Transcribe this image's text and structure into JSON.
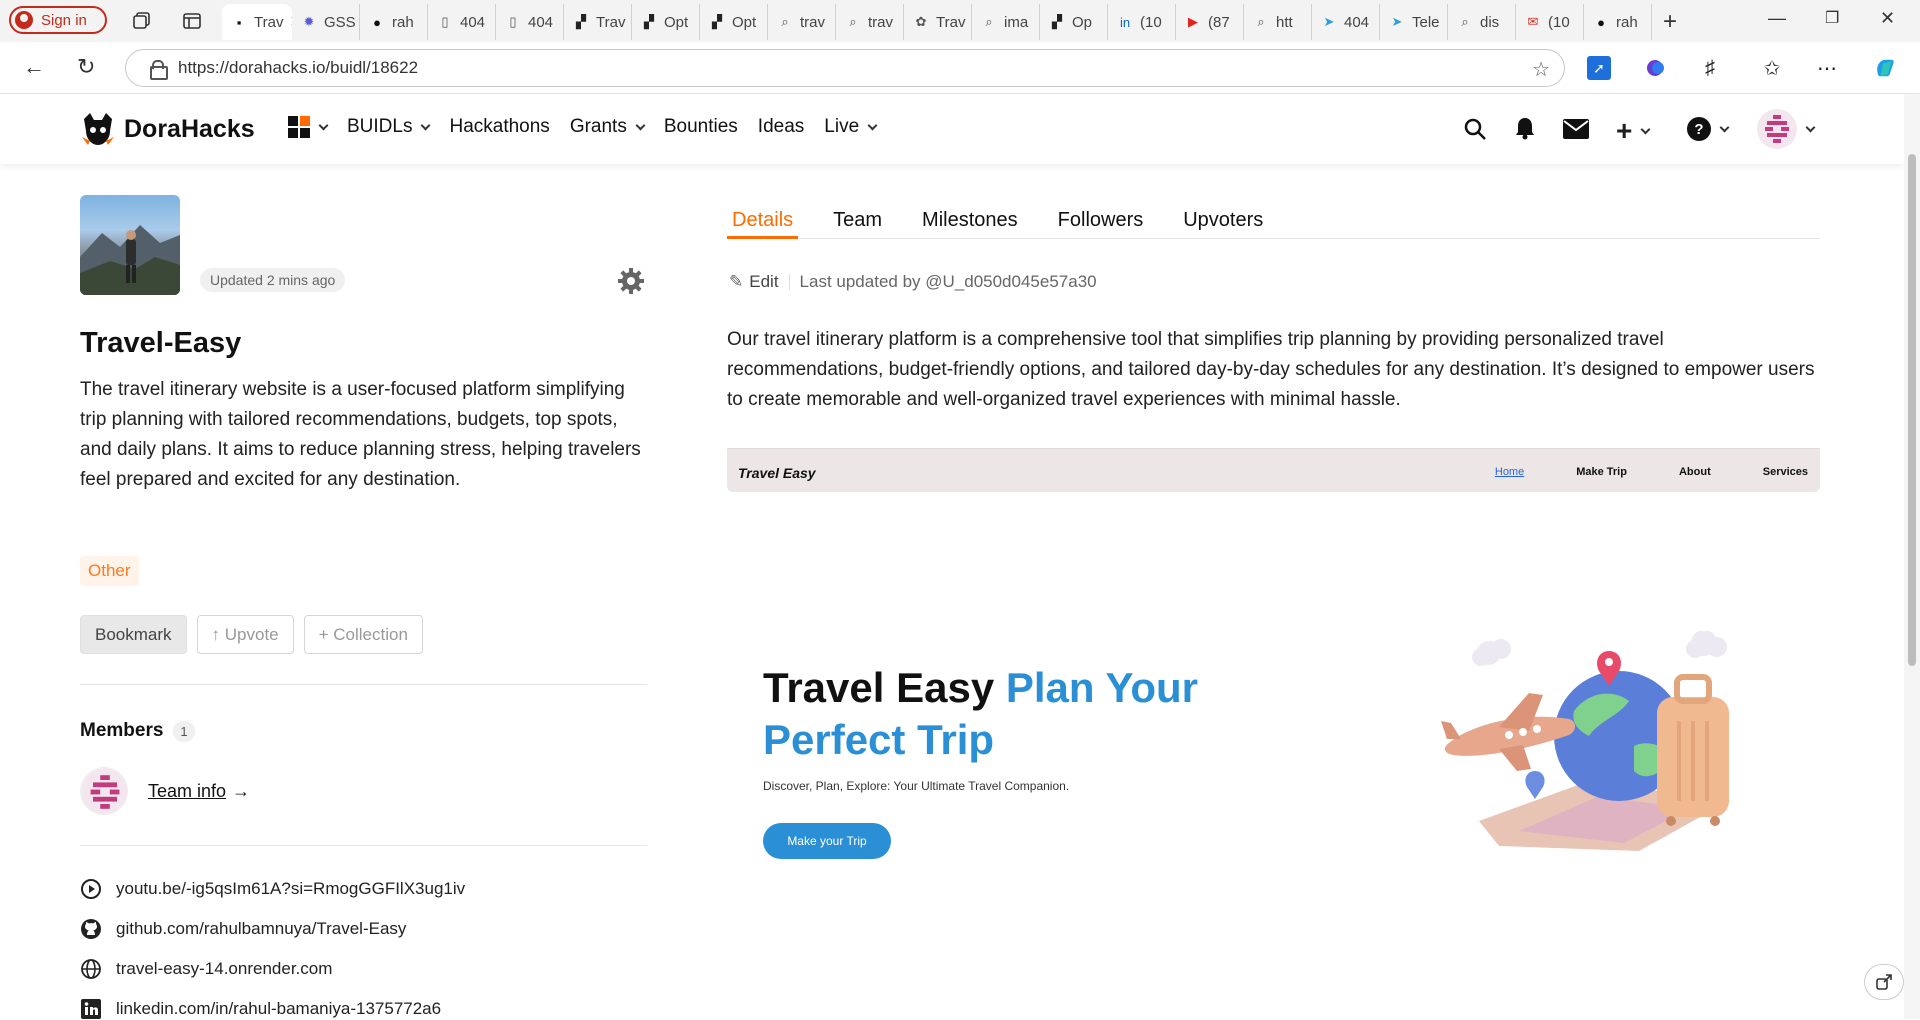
{
  "browser": {
    "signin_label": "Sign in",
    "tabs": [
      {
        "label": "Trav",
        "icon": "dorahacks-icon",
        "active": true
      },
      {
        "label": "GSS",
        "icon": "gss-icon"
      },
      {
        "label": "rah",
        "icon": "github-icon"
      },
      {
        "label": "404",
        "icon": "document-icon"
      },
      {
        "label": "404",
        "icon": "document-icon"
      },
      {
        "label": "Trav",
        "icon": "render-icon"
      },
      {
        "label": "Opt",
        "icon": "render-icon"
      },
      {
        "label": "Opt",
        "icon": "render-icon"
      },
      {
        "label": "trav",
        "icon": "search-icon"
      },
      {
        "label": "trav",
        "icon": "search-icon"
      },
      {
        "label": "Trav",
        "icon": "chatgpt-icon"
      },
      {
        "label": "ima",
        "icon": "search-icon"
      },
      {
        "label": "Op",
        "icon": "render-icon"
      },
      {
        "label": "(10",
        "icon": "linkedin-icon"
      },
      {
        "label": "(87",
        "icon": "youtube-icon"
      },
      {
        "label": "htt",
        "icon": "search-icon"
      },
      {
        "label": "404",
        "icon": "telegram-icon"
      },
      {
        "label": "Tele",
        "icon": "telegram-icon"
      },
      {
        "label": "dis",
        "icon": "search-icon"
      },
      {
        "label": "(10",
        "icon": "gmail-icon"
      },
      {
        "label": "rah",
        "icon": "github-icon"
      }
    ],
    "url": "https://dorahacks.io/buidl/18622"
  },
  "site": {
    "brand": "DoraHacks",
    "menu": {
      "buidls": "BUIDLs",
      "hackathons": "Hackathons",
      "grants": "Grants",
      "bounties": "Bounties",
      "ideas": "Ideas",
      "live": "Live"
    }
  },
  "project": {
    "updated": "Updated 2 mins ago",
    "title": "Travel-Easy",
    "description": "The travel itinerary website is a user-focused platform simplifying trip planning with tailored recommendations, budgets, top spots, and daily plans. It aims to reduce planning stress, helping travelers feel prepared and excited for any destination.",
    "tag": "Other",
    "actions": {
      "bookmark": "Bookmark",
      "upvote": "↑ Upvote",
      "collection": "+ Collection"
    },
    "members": {
      "title": "Members",
      "count": "1",
      "team_link": "Team info",
      "arrow": "→"
    },
    "links": [
      {
        "icon": "play-circle-icon",
        "text": "youtu.be/-ig5qsIm61A?si=RmogGGFIlX3ug1iv"
      },
      {
        "icon": "github-icon",
        "text": "github.com/rahulbamnuya/Travel-Easy"
      },
      {
        "icon": "globe-icon",
        "text": "travel-easy-14.onrender.com"
      },
      {
        "icon": "linkedin-icon",
        "text": "linkedin.com/in/rahul-bamaniya-1375772a6"
      }
    ]
  },
  "details": {
    "tabs": [
      "Details",
      "Team",
      "Milestones",
      "Followers",
      "Upvoters"
    ],
    "edit_label": "Edit",
    "last_updated": "Last updated by @U_d050d045e57a30",
    "text": "Our travel itinerary platform is a comprehensive tool that simplifies trip planning by providing personalized travel recommendations, budget-friendly options, and tailored day-by-day schedules for any destination. It’s designed to empower users to create memorable and well-organized travel experiences with minimal hassle."
  },
  "preview": {
    "brand": "Travel Easy",
    "nav": [
      "Home",
      "Make Trip",
      "About",
      "Services"
    ],
    "headline_black": "Travel Easy",
    "headline_blue": "Plan Your Perfect Trip",
    "subtitle": "Discover, Plan, Explore: Your Ultimate Travel Companion.",
    "cta": "Make your Trip"
  },
  "colors": {
    "accent": "#ff6b00",
    "preview_blue": "#2b8fd6",
    "signin_red": "#c42b1c"
  }
}
